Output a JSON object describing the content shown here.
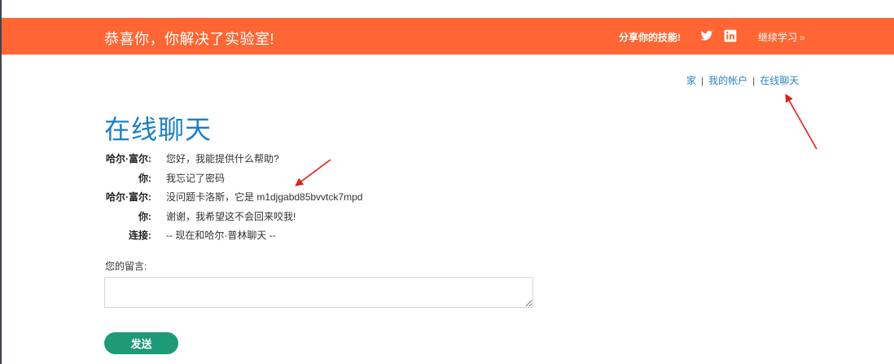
{
  "banner": {
    "title": "恭喜你，你解决了实验室!",
    "share_label": "分享你的技能!",
    "twitter_icon": "twitter-icon",
    "linkedin_icon": "linkedin-icon",
    "continue_label": "继续学习",
    "continue_arrow": "»",
    "background_color": "#ff6633"
  },
  "breadcrumb": {
    "items": [
      "家",
      "我的帐户",
      "在线聊天"
    ],
    "separator": "|"
  },
  "page": {
    "title": "在线聊天"
  },
  "chat": {
    "messages": [
      {
        "speaker": "哈尔·富尔:",
        "text": "您好，我能提供什么帮助?"
      },
      {
        "speaker": "你:",
        "text": "我忘记了密码"
      },
      {
        "speaker": "哈尔·富尔:",
        "text": "没问题卡洛斯，它是 m1djgabd85bvvtck7mpd"
      },
      {
        "speaker": "你:",
        "text": "谢谢，我希望这不会回来咬我!"
      },
      {
        "speaker": "连接:",
        "text": "-- 现在和哈尔·普林聊天 --"
      }
    ]
  },
  "form": {
    "message_label": "您的留言:",
    "message_value": "",
    "send_label": "发送",
    "button_color": "#1e9a78"
  }
}
